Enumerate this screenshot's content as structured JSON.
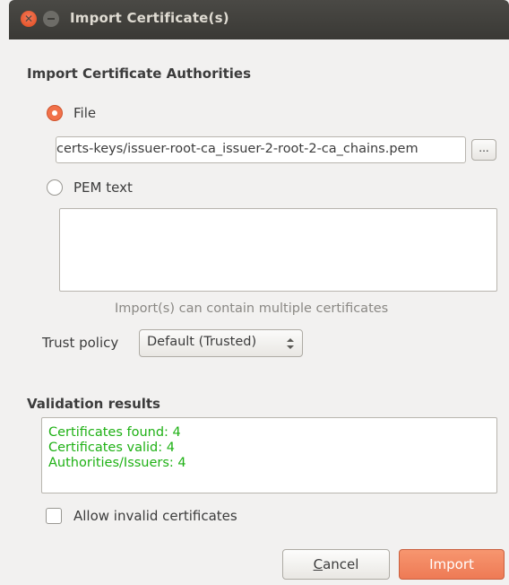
{
  "window": {
    "title": "Import Certificate(s)",
    "close_glyph": "✕"
  },
  "ca_section": {
    "title": "Import Certificate Authorities",
    "file_option": {
      "label": "File",
      "selected": true
    },
    "file_path": "certs-keys/issuer-root-ca_issuer-2-root-2-ca_chains.pem",
    "browse_label": "...",
    "pem_option": {
      "label": "PEM text",
      "selected": false
    },
    "pem_text": "",
    "hint": "Import(s) can contain multiple certificates"
  },
  "trust": {
    "label": "Trust policy",
    "value": "Default (Trusted)"
  },
  "validation": {
    "title": "Validation results",
    "lines": [
      "Certificates found: 4",
      "Certificates valid: 4",
      "Authorities/Issuers: 4"
    ],
    "text_color": "#1fb115"
  },
  "allow_invalid": {
    "label": "Allow invalid certificates",
    "checked": false
  },
  "buttons": {
    "cancel_mnemonic": "C",
    "cancel_rest": "ancel",
    "import": "Import"
  },
  "colors": {
    "accent": "#f1714a",
    "titlebar": "#3e3d39"
  }
}
